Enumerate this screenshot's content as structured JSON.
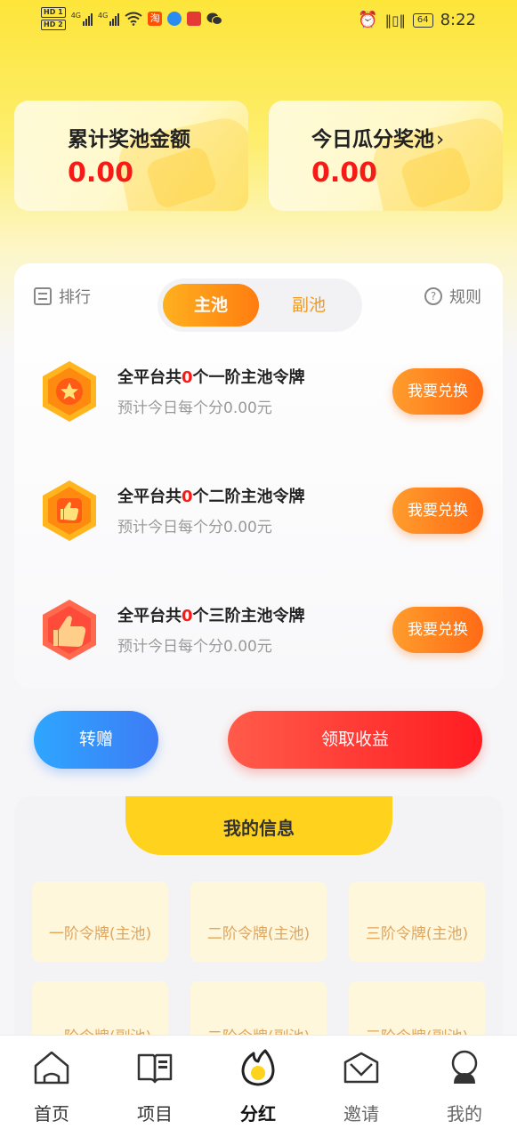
{
  "status_bar": {
    "hd1": "HD 1",
    "hd2": "HD 2",
    "net1": "4G",
    "net2": "4G",
    "battery": "64",
    "time": "8:22"
  },
  "pool_cards": {
    "total_title": "累计奖池金额",
    "total_value": "0.00",
    "today_title": "今日瓜分奖池",
    "today_value": "0.00"
  },
  "panel": {
    "rank_label": "排行",
    "rule_label": "规则",
    "tabs": [
      {
        "label": "主池",
        "active": true
      },
      {
        "label": "副池",
        "active": false
      }
    ],
    "items": [
      {
        "prefix": "全平台共",
        "count": "0",
        "suffix": "个一阶主池令牌",
        "sub": "预计今日每个分0.00元",
        "button": "我要兑换",
        "icon": "star-medal-icon"
      },
      {
        "prefix": "全平台共",
        "count": "0",
        "suffix": "个二阶主池令牌",
        "sub": "预计今日每个分0.00元",
        "button": "我要兑换",
        "icon": "thumbs-up-medal-icon"
      },
      {
        "prefix": "全平台共",
        "count": "0",
        "suffix": "个三阶主池令牌",
        "sub": "预计今日每个分0.00元",
        "button": "我要兑换",
        "icon": "big-thumbs-up-medal-icon"
      }
    ]
  },
  "actions": {
    "gift": "转赠",
    "claim": "领取收益"
  },
  "my_info": {
    "title": "我的信息",
    "cells": [
      "一阶令牌(主池)",
      "二阶令牌(主池)",
      "三阶令牌(主池)",
      "一阶令牌(副池)",
      "二阶令牌(副池)",
      "三阶令牌(副池)"
    ]
  },
  "nav": [
    {
      "label": "首页",
      "icon": "home-icon"
    },
    {
      "label": "项目",
      "icon": "book-icon"
    },
    {
      "label": "分红",
      "icon": "flame-icon",
      "active": true
    },
    {
      "label": "邀请",
      "icon": "envelope-icon"
    },
    {
      "label": "我的",
      "icon": "user-icon"
    }
  ],
  "colors": {
    "accent_red": "#f51b16",
    "accent_orange": "#ff7d0f",
    "accent_yellow": "#ffd21e",
    "blue": "#3d7cf6"
  }
}
